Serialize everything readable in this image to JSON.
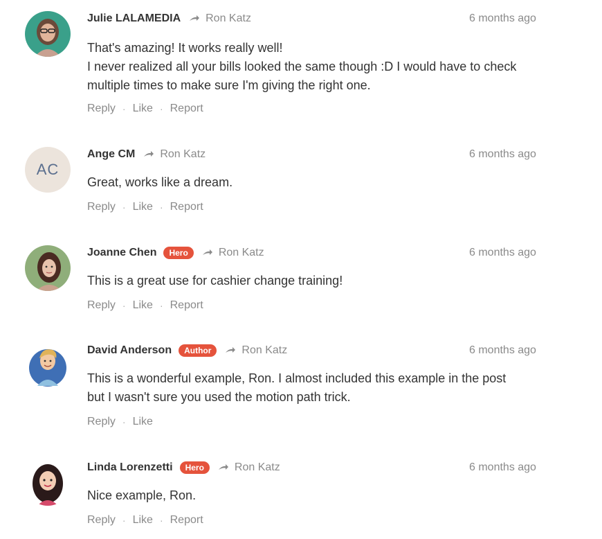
{
  "comments": [
    {
      "author": "Julie LALAMEDIA",
      "reply_to": "Ron Katz",
      "time": "6 months ago",
      "lines": [
        "That's amazing! It works really well!",
        "I never realized all your bills looked the same though :D I would have to check",
        "multiple times to make sure I'm giving the right one."
      ],
      "actions": [
        "Reply",
        "Like",
        "Report"
      ]
    },
    {
      "author": "Ange CM",
      "initials": "AC",
      "reply_to": "Ron Katz",
      "time": "6 months ago",
      "lines": [
        "Great, works like a dream."
      ],
      "actions": [
        "Reply",
        "Like",
        "Report"
      ]
    },
    {
      "author": "Joanne Chen",
      "badge": "Hero",
      "reply_to": "Ron Katz",
      "time": "6 months ago",
      "lines": [
        "This is a great use for cashier change training!"
      ],
      "actions": [
        "Reply",
        "Like",
        "Report"
      ]
    },
    {
      "author": "David Anderson",
      "badge": "Author",
      "reply_to": "Ron Katz",
      "time": "6 months ago",
      "lines": [
        "This is a wonderful example, Ron.  I almost included this example in the post",
        "but I wasn't sure you used the motion path trick."
      ],
      "actions": [
        "Reply",
        "Like"
      ]
    },
    {
      "author": "Linda Lorenzetti",
      "badge": "Hero",
      "reply_to": "Ron Katz",
      "time": "6 months ago",
      "lines": [
        "Nice example, Ron."
      ],
      "actions": [
        "Reply",
        "Like",
        "Report"
      ]
    }
  ],
  "colors": {
    "badge": "#e5533c",
    "muted": "#8a8a8a",
    "text": "#333333"
  }
}
